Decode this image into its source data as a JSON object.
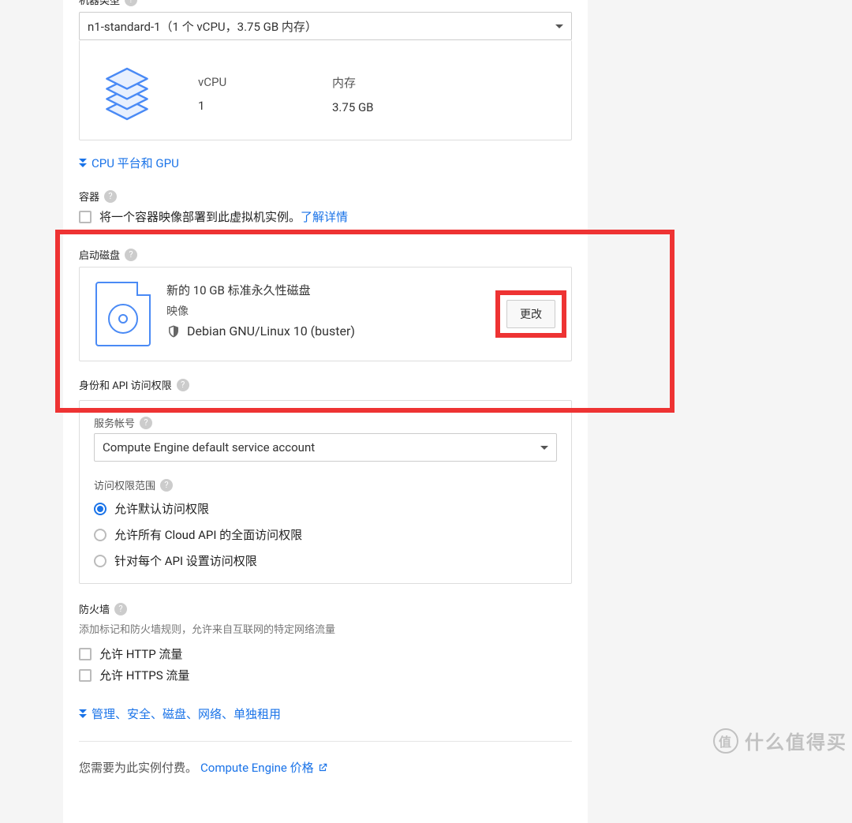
{
  "machine_type": {
    "label": "机器类型",
    "selected": "n1-standard-1（1 个 vCPU，3.75 GB 内存）",
    "specs": {
      "vcpu_label": "vCPU",
      "vcpu_value": "1",
      "memory_label": "内存",
      "memory_value": "3.75 GB"
    },
    "cpu_gpu_link": "CPU 平台和 GPU"
  },
  "container": {
    "label": "容器",
    "deploy_text": "将一个容器映像部署到此虚拟机实例。",
    "learn_more": "了解详情"
  },
  "boot_disk": {
    "label": "启动磁盘",
    "title": "新的 10 GB 标准永久性磁盘",
    "image_label": "映像",
    "image_value": "Debian GNU/Linux 10 (buster)",
    "change_button": "更改"
  },
  "identity": {
    "label": "身份和 API 访问权限",
    "service_account": {
      "label": "服务帐号",
      "selected": "Compute Engine default service account"
    },
    "scopes": {
      "label": "访问权限范围",
      "options": [
        "允许默认访问权限",
        "允许所有 Cloud API 的全面访问权限",
        "针对每个 API 设置访问权限"
      ]
    }
  },
  "firewall": {
    "label": "防火墙",
    "hint": "添加标记和防火墙规则，允许来自互联网的特定网络流量",
    "allow_http": "允许 HTTP 流量",
    "allow_https": "允许 HTTPS 流量"
  },
  "advanced_link": "管理、安全、磁盘、网络、单独租用",
  "footer": {
    "text": "您需要为此实例付费。",
    "pricing_link": "Compute Engine 价格"
  },
  "watermark": {
    "badge": "值",
    "text": "什么值得买"
  }
}
